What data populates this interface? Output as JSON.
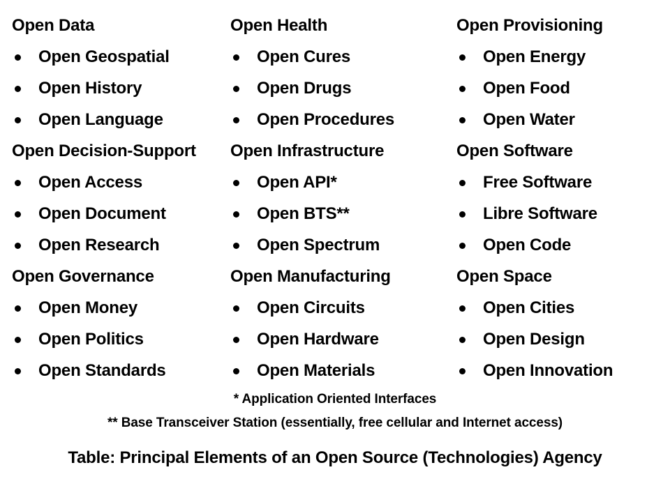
{
  "table": {
    "columns": [
      {
        "groups": [
          {
            "header": "Open Data",
            "items": [
              "Open Geospatial",
              "Open History",
              "Open Language"
            ]
          },
          {
            "header": "Open Decision-Support",
            "items": [
              "Open Access",
              "Open Document",
              "Open Research"
            ]
          },
          {
            "header": "Open Governance",
            "items": [
              "Open Money",
              "Open Politics",
              "Open Standards"
            ]
          }
        ]
      },
      {
        "groups": [
          {
            "header": "Open Health",
            "items": [
              "Open Cures",
              "Open Drugs",
              "Open Procedures"
            ]
          },
          {
            "header": "Open Infrastructure",
            "items": [
              "Open API*",
              "Open BTS**",
              "Open Spectrum"
            ]
          },
          {
            "header": "Open Manufacturing",
            "items": [
              "Open Circuits",
              "Open Hardware",
              "Open Materials"
            ]
          }
        ]
      },
      {
        "groups": [
          {
            "header": "Open Provisioning",
            "items": [
              "Open Energy",
              "Open Food",
              "Open Water"
            ]
          },
          {
            "header": "Open Software",
            "items": [
              "Free Software",
              "Libre Software",
              "Open Code"
            ]
          },
          {
            "header": "Open Space",
            "items": [
              "Open Cities",
              "Open Design",
              "Open Innovation"
            ]
          }
        ]
      }
    ]
  },
  "footnotes": [
    "* Application Oriented Interfaces",
    "** Base Transceiver Station (essentially, free cellular and Internet access)"
  ],
  "caption": "Table: Principal Elements of an Open Source (Technologies) Agency",
  "colors": {
    "text": "#000000",
    "background": "#ffffff"
  }
}
